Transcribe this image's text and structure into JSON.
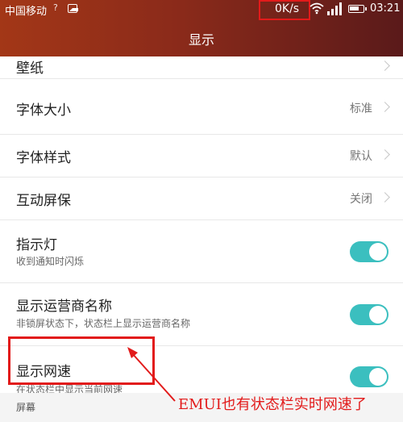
{
  "status_bar": {
    "carrier": "中国移动",
    "carrier_suffix": "?",
    "net_speed": "0K/s",
    "time": "03:21",
    "icons": [
      "image-icon",
      "wifi-icon",
      "signal-icon",
      "battery-icon"
    ]
  },
  "header": {
    "title": "显示"
  },
  "settings": [
    {
      "id": "wallpaper",
      "title": "壁纸",
      "type": "nav"
    },
    {
      "id": "font-size",
      "title": "字体大小",
      "value": "标准",
      "type": "nav"
    },
    {
      "id": "font-style",
      "title": "字体样式",
      "value": "默认",
      "type": "nav"
    },
    {
      "id": "screensaver",
      "title": "互动屏保",
      "value": "关闭",
      "type": "nav"
    },
    {
      "id": "indicator",
      "title": "指示灯",
      "subtitle": "收到通知时闪烁",
      "type": "toggle",
      "on": true
    },
    {
      "id": "carrier-name",
      "title": "显示运营商名称",
      "subtitle": "非锁屏状态下，状态栏上显示运营商名称",
      "type": "toggle",
      "on": true
    },
    {
      "id": "net-speed",
      "title": "显示网速",
      "subtitle": "在状态栏中显示当前网速",
      "type": "toggle",
      "on": true
    }
  ],
  "section": {
    "label": "屏幕"
  },
  "annotation": {
    "text": "EMUI也有状态栏实时网速了"
  },
  "colors": {
    "accent_toggle": "#3bbfbf",
    "annotation_red": "#e21b1b",
    "header_start": "#a33717",
    "header_end": "#5a1a1a"
  }
}
